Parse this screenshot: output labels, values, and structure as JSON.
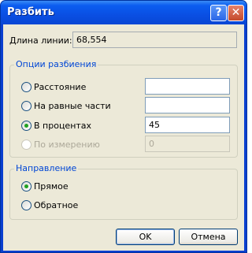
{
  "window": {
    "title": "Разбить"
  },
  "titlebar": {
    "help_glyph": "?",
    "close_glyph": "✕"
  },
  "line_length": {
    "label": "Длина линии:",
    "value": "68,554"
  },
  "split_options": {
    "legend": "Опции разбиения",
    "options": [
      {
        "label": "Расстояние",
        "selected": false,
        "disabled": false,
        "value": ""
      },
      {
        "label": "На равные части",
        "selected": false,
        "disabled": false,
        "value": ""
      },
      {
        "label": "В процентах",
        "selected": true,
        "disabled": false,
        "value": "45"
      },
      {
        "label": "По измерению",
        "selected": false,
        "disabled": true,
        "value": "0"
      }
    ]
  },
  "direction": {
    "legend": "Направление",
    "options": [
      {
        "label": "Прямое",
        "selected": true
      },
      {
        "label": "Обратное",
        "selected": false
      }
    ]
  },
  "buttons": {
    "ok": "OK",
    "cancel": "Отмена"
  },
  "colors": {
    "titlebar": "#0a4fe3",
    "face": "#ece9d8",
    "group_legend": "#0046d5",
    "radio_dot": "#21a121"
  }
}
